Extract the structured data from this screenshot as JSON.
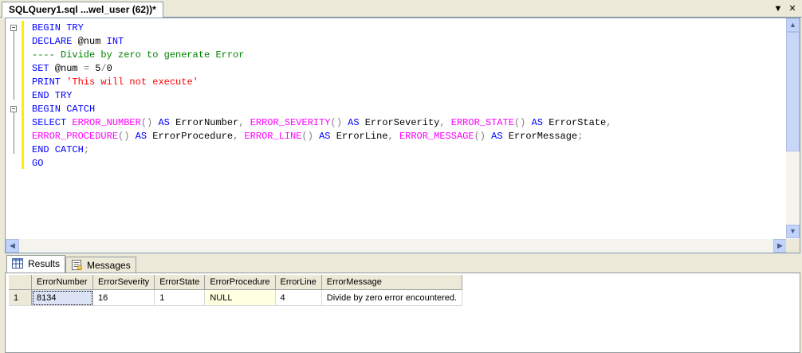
{
  "document_tab": {
    "title": "SQLQuery1.sql ...wel_user (62))*"
  },
  "tab_controls": {
    "dropdown": "▼",
    "close": "✕"
  },
  "editor": {
    "lines": [
      [
        {
          "t": "BEGIN TRY",
          "c": "kw"
        }
      ],
      [
        {
          "t": "DECLARE ",
          "c": "kw"
        },
        {
          "t": "@num ",
          "c": ""
        },
        {
          "t": "INT",
          "c": "kw"
        }
      ],
      [
        {
          "t": "---- Divide by zero to generate Error",
          "c": "cm"
        }
      ],
      [
        {
          "t": "SET ",
          "c": "kw"
        },
        {
          "t": "@num ",
          "c": ""
        },
        {
          "t": "= ",
          "c": "gray"
        },
        {
          "t": "5",
          "c": ""
        },
        {
          "t": "/",
          "c": "gray"
        },
        {
          "t": "0",
          "c": ""
        }
      ],
      [
        {
          "t": "PRINT ",
          "c": "kw"
        },
        {
          "t": "'This will not execute'",
          "c": "str"
        }
      ],
      [
        {
          "t": "END TRY",
          "c": "kw"
        }
      ],
      [
        {
          "t": "BEGIN CATCH",
          "c": "kw"
        }
      ],
      [
        {
          "t": "SELECT ",
          "c": "kw"
        },
        {
          "t": "ERROR_NUMBER",
          "c": "fn"
        },
        {
          "t": "() ",
          "c": "gray"
        },
        {
          "t": "AS ",
          "c": "kw"
        },
        {
          "t": "ErrorNumber",
          "c": ""
        },
        {
          "t": ", ",
          "c": "gray"
        },
        {
          "t": "ERROR_SEVERITY",
          "c": "fn"
        },
        {
          "t": "() ",
          "c": "gray"
        },
        {
          "t": "AS ",
          "c": "kw"
        },
        {
          "t": "ErrorSeverity",
          "c": ""
        },
        {
          "t": ", ",
          "c": "gray"
        },
        {
          "t": "ERROR_STATE",
          "c": "fn"
        },
        {
          "t": "() ",
          "c": "gray"
        },
        {
          "t": "AS ",
          "c": "kw"
        },
        {
          "t": "ErrorState",
          "c": ""
        },
        {
          "t": ",",
          "c": "gray"
        }
      ],
      [
        {
          "t": "ERROR_PROCEDURE",
          "c": "fn"
        },
        {
          "t": "() ",
          "c": "gray"
        },
        {
          "t": "AS ",
          "c": "kw"
        },
        {
          "t": "ErrorProcedure",
          "c": ""
        },
        {
          "t": ", ",
          "c": "gray"
        },
        {
          "t": "ERROR_LINE",
          "c": "fn"
        },
        {
          "t": "() ",
          "c": "gray"
        },
        {
          "t": "AS ",
          "c": "kw"
        },
        {
          "t": "ErrorLine",
          "c": ""
        },
        {
          "t": ", ",
          "c": "gray"
        },
        {
          "t": "ERROR_MESSAGE",
          "c": "fn"
        },
        {
          "t": "() ",
          "c": "gray"
        },
        {
          "t": "AS ",
          "c": "kw"
        },
        {
          "t": "ErrorMessage",
          "c": ""
        },
        {
          "t": ";",
          "c": "gray"
        }
      ],
      [
        {
          "t": "END CATCH",
          "c": "kw"
        },
        {
          "t": ";",
          "c": "gray"
        }
      ],
      [
        {
          "t": "GO",
          "c": "kw"
        }
      ]
    ]
  },
  "results_tabs": {
    "results_label": "Results",
    "messages_label": "Messages"
  },
  "grid": {
    "columns": [
      "ErrorNumber",
      "ErrorSeverity",
      "ErrorState",
      "ErrorProcedure",
      "ErrorLine",
      "ErrorMessage"
    ],
    "rows": [
      {
        "rownum": "1",
        "cells": [
          "8134",
          "16",
          "1",
          "NULL",
          "4",
          "Divide by zero error encountered."
        ]
      }
    ]
  },
  "scroll_arrows": {
    "up": "▲",
    "down": "▼",
    "left": "◀",
    "right": "▶"
  }
}
